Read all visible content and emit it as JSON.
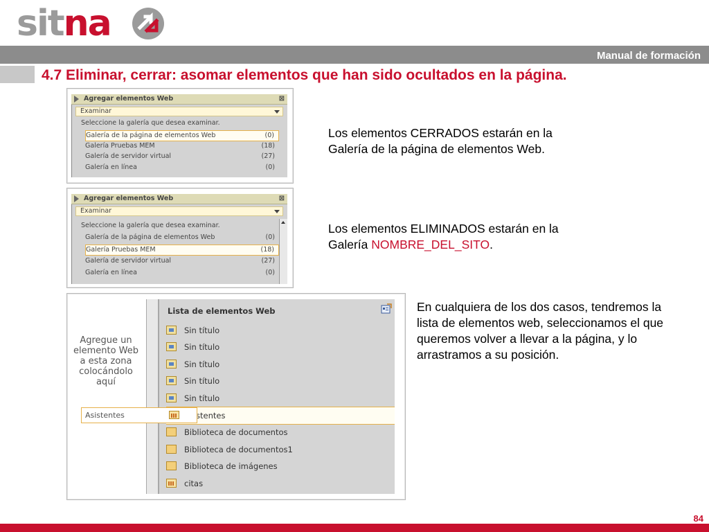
{
  "header": {
    "logo": "sitna",
    "manual_label": "Manual de formación",
    "title": "4.7 Eliminar, cerrar: asomar elementos que han sido ocultados en la página."
  },
  "footer": {
    "page_number": "84"
  },
  "colors": {
    "brand_red": "#c8102e",
    "logo_gray": "#9b9b9b",
    "bar_gray": "#8c8c8c"
  },
  "shot1": {
    "panel_title": "Agregar elementos Web",
    "close_glyph": "⊠",
    "select_value": "Examinar",
    "prompt": "Seleccione la galería que desea examinar.",
    "rows": [
      {
        "label": "Galería de la página de elementos Web",
        "count": "(0)"
      },
      {
        "label": "Galería Pruebas MEM",
        "count": "(18)"
      },
      {
        "label": "Galería de servidor virtual",
        "count": "(27)"
      },
      {
        "label": "Galería en línea",
        "count": "(0)"
      }
    ]
  },
  "shot2": {
    "panel_title": "Agregar elementos Web",
    "close_glyph": "⊠",
    "select_value": "Examinar",
    "prompt": "Seleccione la galería que desea examinar.",
    "rows": [
      {
        "label": "Galería de la página de elementos Web",
        "count": "(0)"
      },
      {
        "label": "Galería Pruebas MEM",
        "count": "(18)"
      },
      {
        "label": "Galería de servidor virtual",
        "count": "(27)"
      },
      {
        "label": "Galería en línea",
        "count": "(0)"
      }
    ]
  },
  "shot3": {
    "drop_zone_lines": [
      "Agregue un",
      "elemento Web",
      "a esta zona",
      "colocándolo",
      "aquí"
    ],
    "drag_label": "Asistentes",
    "list_title": "Lista de elementos Web",
    "items": [
      {
        "label": "Sin título",
        "icon": "web-part-icon"
      },
      {
        "label": "Sin título",
        "icon": "web-part-icon"
      },
      {
        "label": "Sin título",
        "icon": "web-part-icon"
      },
      {
        "label": "Sin título",
        "icon": "web-part-icon"
      },
      {
        "label": "Sin título",
        "icon": "web-part-icon"
      },
      {
        "label": "Asistentes",
        "icon": "list-icon"
      },
      {
        "label": "Biblioteca de documentos",
        "icon": "library-icon"
      },
      {
        "label": "Biblioteca de documentos1",
        "icon": "library-icon"
      },
      {
        "label": "Biblioteca de imágenes",
        "icon": "library-icon"
      },
      {
        "label": "citas",
        "icon": "calendar-icon"
      }
    ]
  },
  "text1": "Los elementos CERRADOS estarán en la Galería de la página de elementos Web.",
  "text2": {
    "prefix": "Los elementos ELIMINADOS estarán en la Galería ",
    "highlight": "NOMBRE_DEL_SITO",
    "suffix": "."
  },
  "text3": "En cualquiera de los dos casos, tendremos la lista de elementos web, seleccionamos el que queremos volver a llevar a la página, y lo arrastramos a su posición."
}
